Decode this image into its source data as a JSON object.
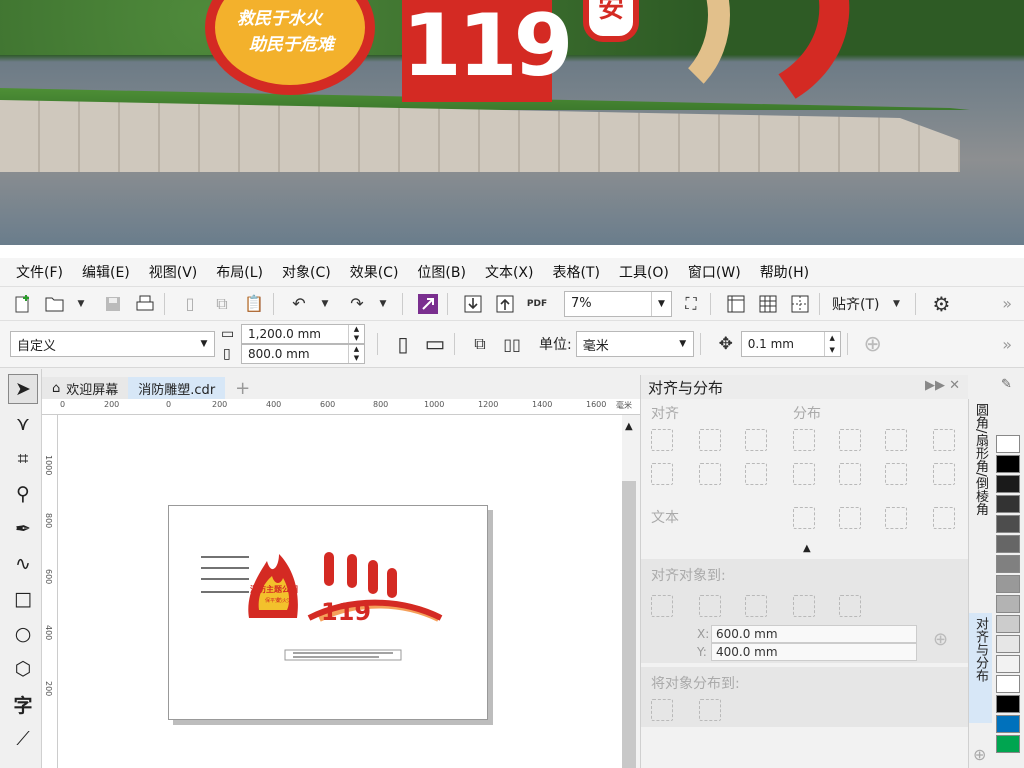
{
  "menu": [
    "文件(F)",
    "编辑(E)",
    "视图(V)",
    "布局(L)",
    "对象(C)",
    "效果(C)",
    "位图(B)",
    "文本(X)",
    "表格(T)",
    "工具(O)",
    "窗口(W)",
    "帮助(H)"
  ],
  "toolbar1": {
    "zoom_value": "7%",
    "pdf_label": "PDF",
    "snap_label": "贴齐(T)"
  },
  "toolbar2": {
    "page_preset": "自定义",
    "width": "1,200.0 mm",
    "height": "800.0 mm",
    "units_label": "单位:",
    "units_value": "毫米",
    "nudge": "0.1 mm"
  },
  "tabs": {
    "home": "欢迎屏幕",
    "document": "消防雕塑.cdr"
  },
  "ruler": {
    "h_ticks": [
      "0",
      "200",
      "0",
      "200",
      "400",
      "600",
      "800",
      "1000",
      "1200",
      "1400",
      "1600"
    ],
    "unit": "毫米",
    "v_ticks": [
      "1000",
      "800",
      "600",
      "400",
      "200"
    ]
  },
  "artwork": {
    "badge_title": "消防主题公园",
    "badge_sub1": "保平安",
    "badge_sub2": "防火灾",
    "number": "119",
    "strip_labels": [
      "户户平安",
      "安全用火",
      "关爱生命",
      "平安家园"
    ]
  },
  "photo": {
    "slogan1": "救民于水火",
    "slogan2": "助民于危难",
    "number": "119",
    "badge": "安"
  },
  "docker": {
    "title": "对齐与分布",
    "align_label": "对齐",
    "distribute_label": "分布",
    "text_label": "文本",
    "align_to_label": "对齐对象到:",
    "x_label": "X:",
    "x_value": "600.0 mm",
    "y_label": "Y:",
    "y_value": "400.0 mm",
    "distribute_to_label": "将对象分布到:"
  },
  "side_tabs": [
    "圆角/扇形角/倒棱角",
    "对齐与分布"
  ],
  "palette": [
    "#ffffff",
    "#000000",
    "#1a1a1a",
    "#333333",
    "#4d4d4d",
    "#666666",
    "#808080",
    "#999999",
    "#b3b3b3",
    "#cccccc",
    "#e6e6e6",
    "#f2f2f2",
    "#ffffff",
    "#000000",
    "#0071bc",
    "#00a550"
  ]
}
